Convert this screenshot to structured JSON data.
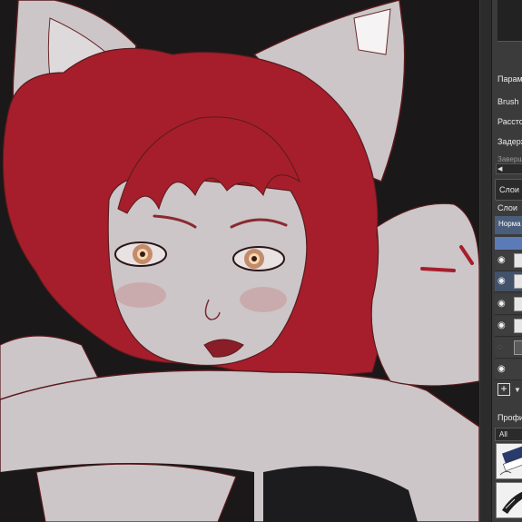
{
  "canvas": {
    "artwork": "cat-eared red-haired girl sketch",
    "colors": {
      "background": "#1a1818",
      "hair": "#a61e2b",
      "skin": "#ccc6c8",
      "line": "#5a1a1e",
      "eye_glow": "#f4d9b0"
    }
  },
  "panel": {
    "params_label": "Парам",
    "brush_label": "Brush",
    "spacing_label": "Рассто",
    "delay_label": "Задерж",
    "finish_label": "Заверш",
    "blend_value": "Слои",
    "layers_label": "Слои",
    "layer_mode": "Норма",
    "profiles_label": "Профи",
    "profile_value": "All",
    "layers": [
      {
        "visible": true,
        "active": false
      },
      {
        "visible": true,
        "active": true
      },
      {
        "visible": true,
        "active": false
      },
      {
        "visible": true,
        "active": false
      },
      {
        "visible": false,
        "active": false
      },
      {
        "visible": true,
        "active": false
      }
    ],
    "accent": "#5b7bb8"
  }
}
